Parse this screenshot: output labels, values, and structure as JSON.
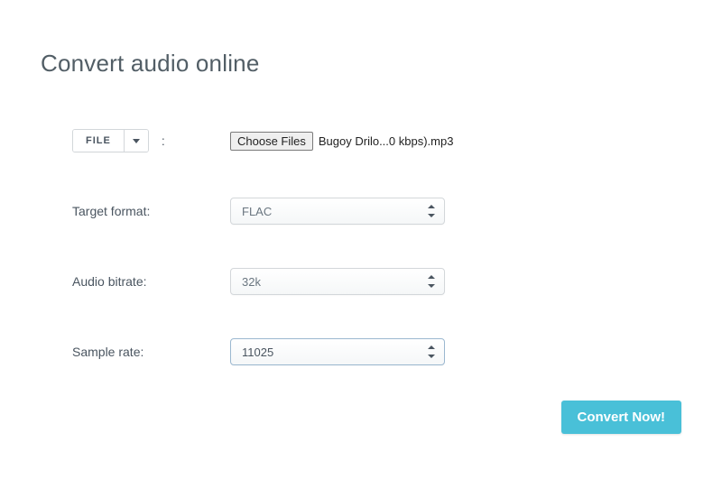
{
  "title": "Convert audio online",
  "file_input": {
    "button_label": "FILE",
    "choose_label": "Choose Files",
    "filename": "Bugoy Drilo...0 kbps).mp3"
  },
  "fields": {
    "target_format": {
      "label": "Target format:",
      "value": "FLAC"
    },
    "audio_bitrate": {
      "label": "Audio bitrate:",
      "value": "32k"
    },
    "sample_rate": {
      "label": "Sample rate:",
      "value": "11025"
    }
  },
  "convert_label": "Convert Now!",
  "colon": ":"
}
